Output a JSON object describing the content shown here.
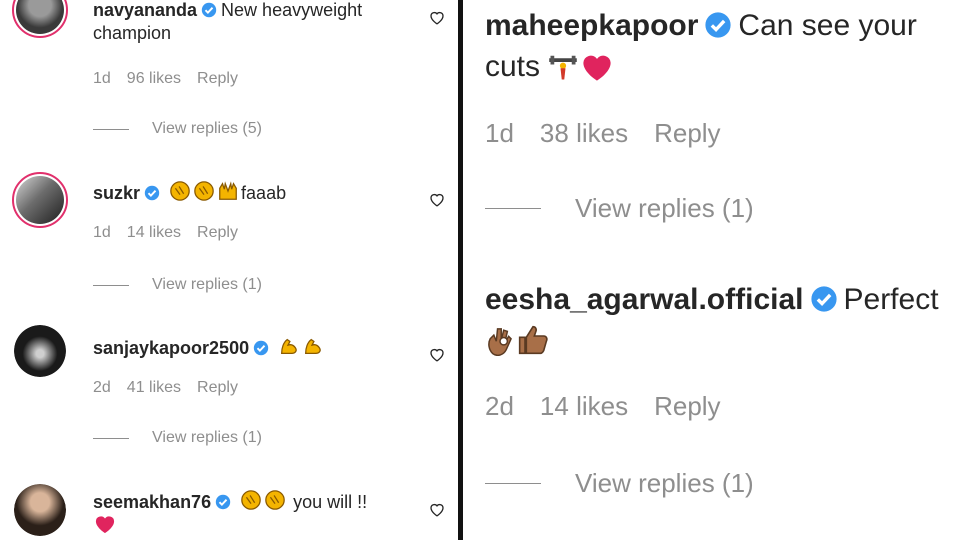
{
  "left_comments": [
    {
      "username": "navyananda",
      "text": "New heavyweight champion",
      "emojis": [],
      "time": "1d",
      "likes": "96 likes",
      "reply": "Reply",
      "view_replies": "View replies (5)"
    },
    {
      "username": "suzkr",
      "text": "faaab",
      "emojis": [
        "clap-emoji",
        "clap-emoji",
        "raised-hands-emoji"
      ],
      "time": "1d",
      "likes": "14 likes",
      "reply": "Reply",
      "view_replies": "View replies (1)"
    },
    {
      "username": "sanjaykapoor2500",
      "text": "",
      "emojis": [
        "flexed-biceps-emoji",
        "flexed-biceps-emoji"
      ],
      "time": "2d",
      "likes": "41 likes",
      "reply": "Reply",
      "view_replies": "View replies (1)"
    },
    {
      "username": "seemakhan76",
      "text": "you will !!",
      "emojis": [
        "clap-emoji",
        "clap-emoji",
        "red-heart-emoji"
      ],
      "time": "",
      "likes": "",
      "reply": "",
      "view_replies": ""
    }
  ],
  "right_comments": [
    {
      "username": "maheepkapoor",
      "text": "Can see your cuts",
      "emojis": [
        "weight-lifter-emoji",
        "red-heart-emoji"
      ],
      "time": "1d",
      "likes": "38 likes",
      "reply": "Reply",
      "view_replies": "View replies (1)"
    },
    {
      "username": "eesha_agarwal.official",
      "text": "Perfect",
      "emojis": [
        "ok-hand-emoji",
        "thumbs-up-emoji"
      ],
      "time": "2d",
      "likes": "14 likes",
      "reply": "Reply",
      "view_replies": "View replies (1)"
    }
  ],
  "colors": {
    "verified": "#3897f0",
    "meta_text": "#8e8e8e",
    "story_ring": "#e1306c",
    "divider": "#111111"
  }
}
